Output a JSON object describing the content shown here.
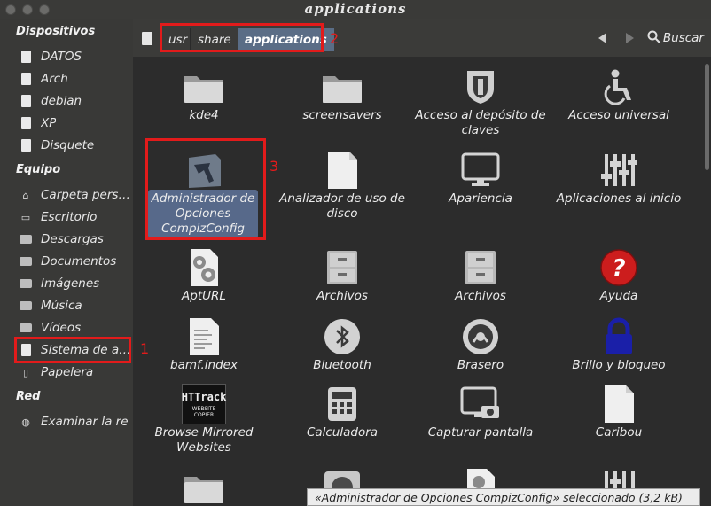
{
  "window": {
    "title": "applications"
  },
  "sidebar": {
    "sections": [
      {
        "heading": "Dispositivos",
        "items": [
          "DATOS",
          "Arch",
          "debian",
          "XP",
          "Disquete"
        ]
      },
      {
        "heading": "Equipo",
        "items": [
          "Carpeta pers…",
          "Escritorio",
          "Descargas",
          "Documentos",
          "Imágenes",
          "Música",
          "Vídeos",
          "Sistema de a…",
          "Papelera"
        ]
      },
      {
        "heading": "Red",
        "items": [
          "Examinar la red"
        ]
      }
    ]
  },
  "pathbar": {
    "crumbs": [
      "usr",
      "share",
      "applications"
    ],
    "search_label": "Buscar"
  },
  "files": [
    {
      "name": "kde4",
      "icon": "folder-icon"
    },
    {
      "name": "screensavers",
      "icon": "folder-icon"
    },
    {
      "name": "Acceso al depósito de claves",
      "icon": "shield-icon"
    },
    {
      "name": "Acceso universal",
      "icon": "accessibility-icon"
    },
    {
      "name": "Administrador de Opciones CompizConfig",
      "icon": "compizconfig-icon",
      "selected": true
    },
    {
      "name": "Analizador de uso de disco",
      "icon": "document-icon"
    },
    {
      "name": "Apariencia",
      "icon": "monitor-icon"
    },
    {
      "name": "Aplicaciones al inicio",
      "icon": "sliders-icon"
    },
    {
      "name": "AptURL",
      "icon": "gear-document-icon"
    },
    {
      "name": "Archivos",
      "icon": "file-cabinet-icon"
    },
    {
      "name": "Archivos",
      "icon": "file-cabinet-icon"
    },
    {
      "name": "Ayuda",
      "icon": "help-icon"
    },
    {
      "name": "bamf.index",
      "icon": "text-document-icon"
    },
    {
      "name": "Bluetooth",
      "icon": "bluetooth-icon"
    },
    {
      "name": "Brasero",
      "icon": "brasero-icon"
    },
    {
      "name": "Brillo y bloqueo",
      "icon": "lock-icon"
    },
    {
      "name": "Browse Mirrored Websites",
      "icon": "httrack-icon"
    },
    {
      "name": "Calculadora",
      "icon": "calculator-icon"
    },
    {
      "name": "Capturar pantalla",
      "icon": "screenshot-icon"
    },
    {
      "name": "Caribou",
      "icon": "document-icon"
    }
  ],
  "annotations": {
    "marker_1": "1",
    "marker_2": "2",
    "marker_3": "3",
    "color": "#e21b1b"
  },
  "httrack_logo": {
    "line1": "HTTrack",
    "line2": "WEBSITE COPIER"
  },
  "status": {
    "text": "«Administrador de Opciones CompizConfig» seleccionado (3,2 kB)"
  },
  "colors": {
    "selection": "#57698a",
    "active_crumb": "#5a6d86",
    "background": "#2c2c2c"
  }
}
